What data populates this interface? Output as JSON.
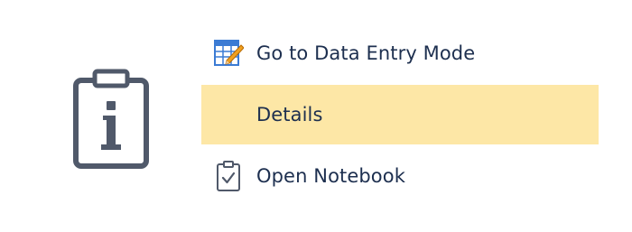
{
  "menu": {
    "items": [
      {
        "label": "Go to Data Entry Mode",
        "icon": "data-entry-edit-icon",
        "selected": false
      },
      {
        "label": "Details",
        "icon": "",
        "selected": true
      },
      {
        "label": "Open Notebook",
        "icon": "notebook-check-icon",
        "selected": false
      }
    ]
  },
  "info_icon": "clipboard-info-icon",
  "colors": {
    "selected_background": "#fde7a6",
    "text": "#1d2f4f",
    "icon_stroke": "#50596a",
    "edit_icon_blue": "#3b7bd4",
    "edit_icon_orange": "#f0a020"
  }
}
